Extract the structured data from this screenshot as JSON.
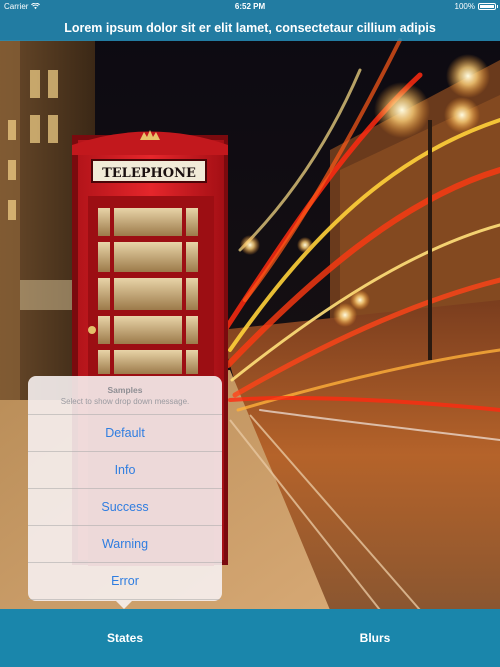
{
  "status_bar": {
    "carrier": "Carrier",
    "time": "6:52 PM",
    "battery": "100%"
  },
  "nav": {
    "title": "Lorem ipsum dolor sit er elit lamet, consectetaur cillium adipis"
  },
  "background": {
    "sign_text": "TELEPHONE"
  },
  "popover": {
    "title": "Samples",
    "subtitle": "Select to show drop down message.",
    "items": [
      {
        "label": "Default"
      },
      {
        "label": "Info"
      },
      {
        "label": "Success"
      },
      {
        "label": "Warning"
      },
      {
        "label": "Error"
      }
    ]
  },
  "tabs": [
    {
      "label": "States"
    },
    {
      "label": "Blurs"
    }
  ],
  "colors": {
    "nav_bar": "#268cb6",
    "tab_bar": "#1a86ab",
    "item_text": "#2f7de0"
  }
}
